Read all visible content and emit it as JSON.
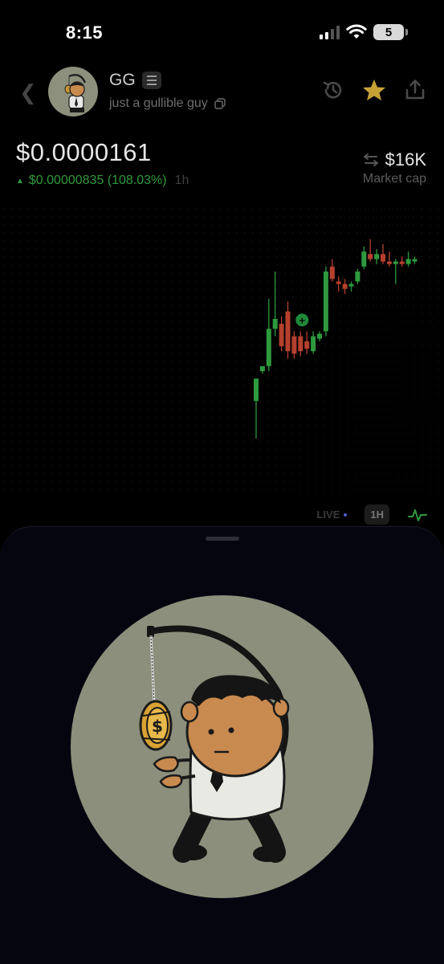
{
  "status_bar": {
    "time": "8:15",
    "battery": "5",
    "icons": [
      "signal-icon",
      "wifi-icon",
      "battery-icon"
    ]
  },
  "header": {
    "name": "GG",
    "description": "just a gullible guy",
    "icons": [
      "back-icon",
      "solana-icon",
      "copy-icon",
      "history-icon",
      "star-icon",
      "share-icon"
    ],
    "star_color": "#c6a136"
  },
  "price": {
    "value": "$0.0000161",
    "change": "$0.00000835 (108.03%)",
    "timeframe": "1h",
    "market_cap": "$16K",
    "market_cap_label": "Market cap"
  },
  "chart_controls": {
    "live": "LIVE",
    "timeframe": "1H"
  },
  "colors": {
    "up": "#2e9a3d",
    "down": "#b5402e",
    "background": "#000000",
    "sheet": "#05050f"
  },
  "chart_data": {
    "type": "candlestick",
    "series": [
      {
        "o": 0.9,
        "h": 1.35,
        "l": 0.15,
        "c": 1.35
      },
      {
        "o": 1.5,
        "h": 1.6,
        "l": 1.45,
        "c": 1.6
      },
      {
        "o": 1.6,
        "h": 2.95,
        "l": 1.5,
        "c": 2.35
      },
      {
        "o": 2.35,
        "h": 3.5,
        "l": 2.2,
        "c": 2.55
      },
      {
        "o": 2.45,
        "h": 2.6,
        "l": 1.9,
        "c": 2.0
      },
      {
        "o": 2.7,
        "h": 2.9,
        "l": 1.75,
        "c": 1.9
      },
      {
        "o": 2.2,
        "h": 2.3,
        "l": 1.75,
        "c": 1.85
      },
      {
        "o": 2.2,
        "h": 2.3,
        "l": 1.8,
        "c": 1.9
      },
      {
        "o": 2.1,
        "h": 2.3,
        "l": 1.85,
        "c": 1.95
      },
      {
        "o": 1.9,
        "h": 2.3,
        "l": 1.85,
        "c": 2.2
      },
      {
        "o": 2.15,
        "h": 2.3,
        "l": 2.1,
        "c": 2.25
      },
      {
        "o": 2.3,
        "h": 3.6,
        "l": 2.2,
        "c": 3.5
      },
      {
        "o": 3.6,
        "h": 3.75,
        "l": 3.3,
        "c": 3.35
      },
      {
        "o": 3.3,
        "h": 3.4,
        "l": 3.1,
        "c": 3.25
      },
      {
        "o": 3.25,
        "h": 3.35,
        "l": 3.05,
        "c": 3.15
      },
      {
        "o": 3.2,
        "h": 3.3,
        "l": 3.1,
        "c": 3.25
      },
      {
        "o": 3.3,
        "h": 3.55,
        "l": 3.25,
        "c": 3.5
      },
      {
        "o": 3.6,
        "h": 4.0,
        "l": 3.55,
        "c": 3.9
      },
      {
        "o": 3.85,
        "h": 4.15,
        "l": 3.7,
        "c": 3.75
      },
      {
        "o": 3.75,
        "h": 3.95,
        "l": 3.65,
        "c": 3.85
      },
      {
        "o": 3.85,
        "h": 4.05,
        "l": 3.65,
        "c": 3.7
      },
      {
        "o": 3.7,
        "h": 3.9,
        "l": 3.6,
        "c": 3.65
      },
      {
        "o": 3.65,
        "h": 3.75,
        "l": 3.25,
        "c": 3.7
      },
      {
        "o": 3.7,
        "h": 3.8,
        "l": 3.6,
        "c": 3.65
      },
      {
        "o": 3.65,
        "h": 3.9,
        "l": 3.6,
        "c": 3.75
      },
      {
        "o": 3.7,
        "h": 3.8,
        "l": 3.65,
        "c": 3.75
      }
    ],
    "marker_index": 7
  }
}
